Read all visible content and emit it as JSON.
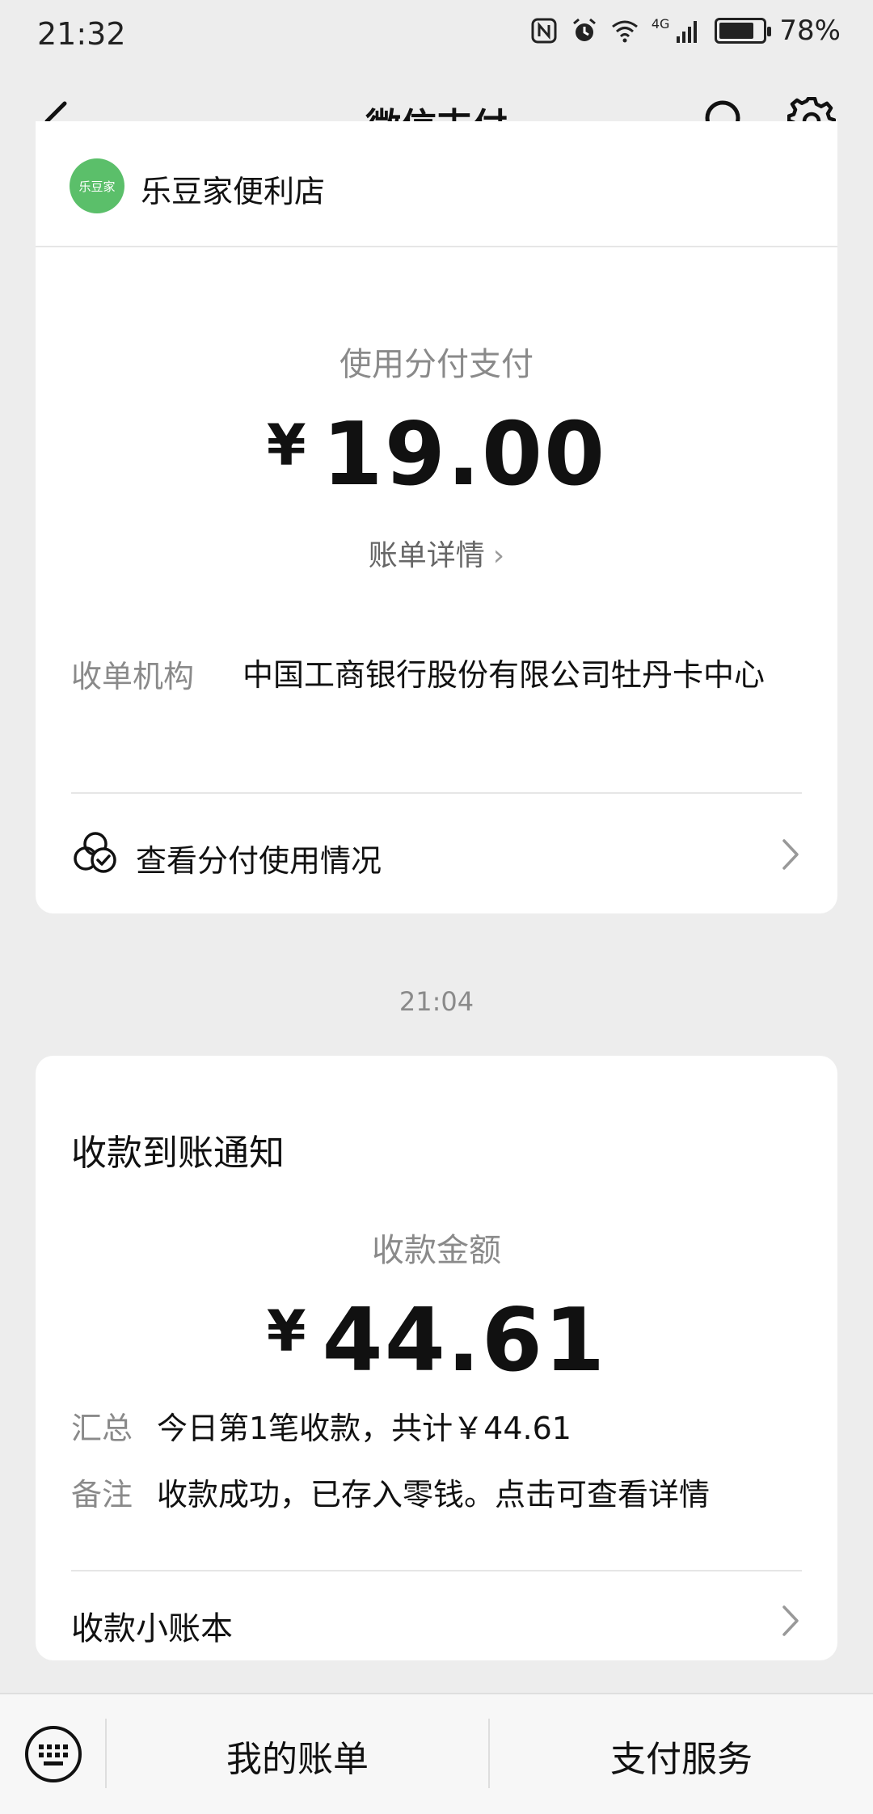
{
  "status_bar": {
    "time": "21:32",
    "network": "4G",
    "battery": "78%",
    "battery_level": 0.78
  },
  "nav": {
    "title": "微信支付",
    "icons": [
      "back-icon",
      "search-icon",
      "gear-icon"
    ]
  },
  "card1": {
    "merchant_logo_text": "乐豆家",
    "merchant_name": "乐豆家便利店",
    "pay_label": "使用分付支付",
    "currency": "¥",
    "amount": "19.00",
    "bill_detail": "账单详情",
    "acquirer_label": "收单机构",
    "acquirer_value": "中国工商银行股份有限公司牡丹卡中心",
    "usage_link": "查看分付使用情况"
  },
  "timestamp": "21:04",
  "card2": {
    "title": "收款到账通知",
    "amount_label": "收款金额",
    "currency": "¥",
    "amount": "44.61",
    "summary_label": "汇总",
    "summary_value": "今日第1笔收款，共计￥44.61",
    "remark_label": "备注",
    "remark_value": "收款成功，已存入零钱。点击可查看详情",
    "ledger_link": "收款小账本"
  },
  "bottom_bar": {
    "my_bills": "我的账单",
    "pay_services": "支付服务"
  }
}
